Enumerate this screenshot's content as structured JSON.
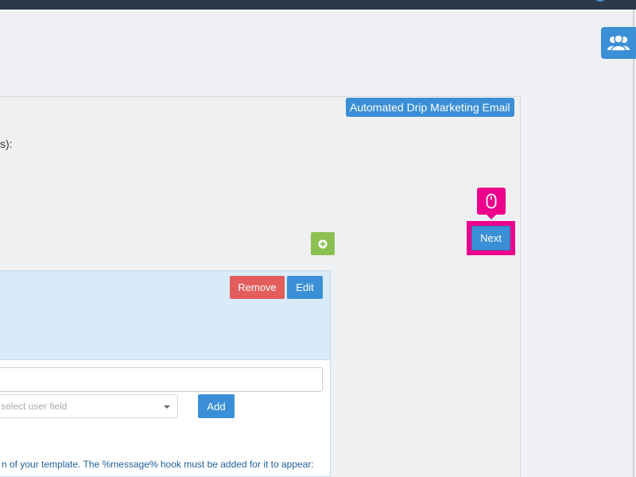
{
  "header": {
    "badge": "Automated Drip Marketing Email"
  },
  "panel": {
    "partial_label": "s):"
  },
  "actions": {
    "next_label": "Next",
    "add_icon": "plus-circle-icon",
    "users_icon": "users-icon",
    "cursor_icon": "mouse-icon"
  },
  "card": {
    "remove_label": "Remove",
    "edit_label": "Edit",
    "text_input_value": "",
    "select_placeholder": "select user field",
    "add_label": "Add",
    "hint_text": "n of your template. The %message% hook must be added for it to appear:"
  },
  "colors": {
    "accent": "#3a8fd6",
    "danger": "#e35d5d",
    "success": "#8cc152",
    "highlight": "#ec008c"
  }
}
